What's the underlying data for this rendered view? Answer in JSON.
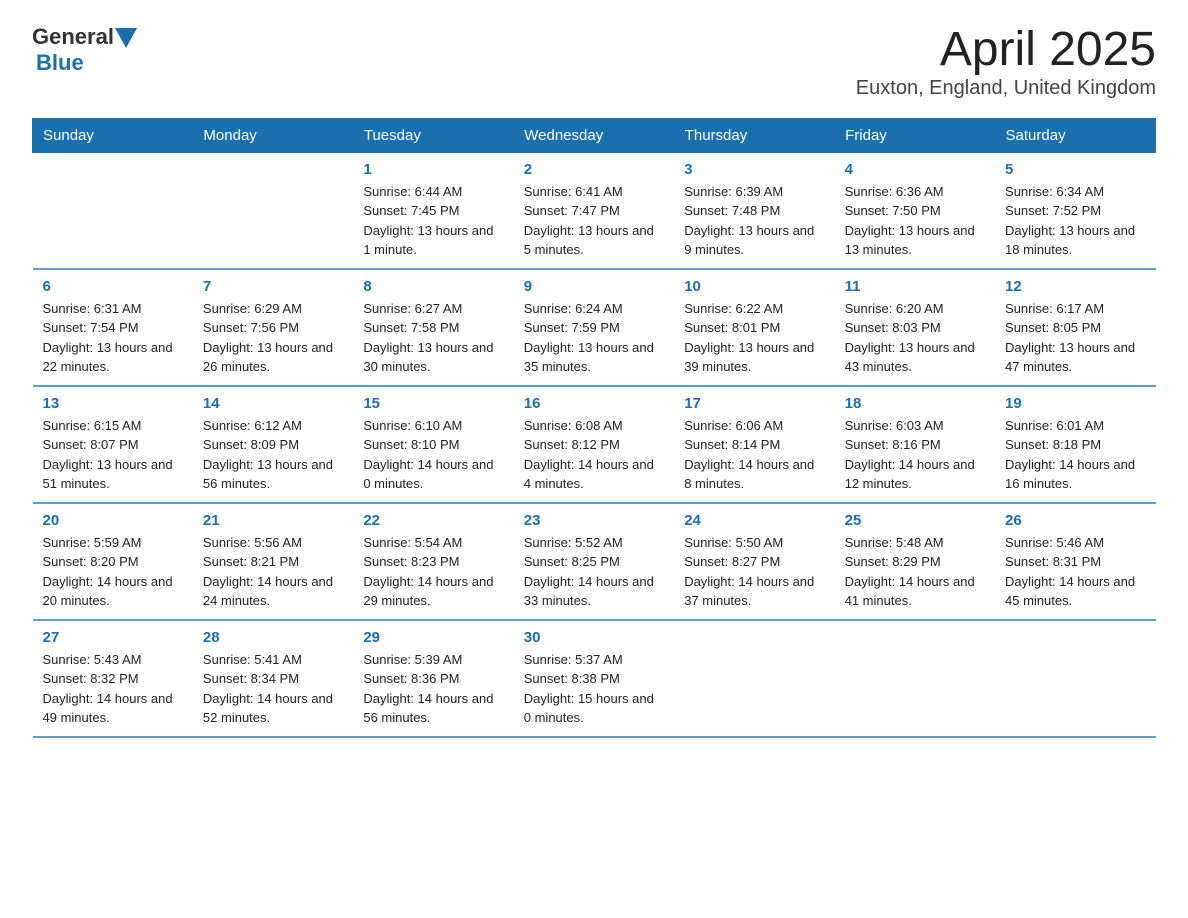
{
  "logo": {
    "general": "General",
    "blue": "Blue"
  },
  "title": "April 2025",
  "subtitle": "Euxton, England, United Kingdom",
  "days_of_week": [
    "Sunday",
    "Monday",
    "Tuesday",
    "Wednesday",
    "Thursday",
    "Friday",
    "Saturday"
  ],
  "weeks": [
    [
      {
        "day": "",
        "info": ""
      },
      {
        "day": "",
        "info": ""
      },
      {
        "day": "1",
        "info": "Sunrise: 6:44 AM\nSunset: 7:45 PM\nDaylight: 13 hours and 1 minute."
      },
      {
        "day": "2",
        "info": "Sunrise: 6:41 AM\nSunset: 7:47 PM\nDaylight: 13 hours and 5 minutes."
      },
      {
        "day": "3",
        "info": "Sunrise: 6:39 AM\nSunset: 7:48 PM\nDaylight: 13 hours and 9 minutes."
      },
      {
        "day": "4",
        "info": "Sunrise: 6:36 AM\nSunset: 7:50 PM\nDaylight: 13 hours and 13 minutes."
      },
      {
        "day": "5",
        "info": "Sunrise: 6:34 AM\nSunset: 7:52 PM\nDaylight: 13 hours and 18 minutes."
      }
    ],
    [
      {
        "day": "6",
        "info": "Sunrise: 6:31 AM\nSunset: 7:54 PM\nDaylight: 13 hours and 22 minutes."
      },
      {
        "day": "7",
        "info": "Sunrise: 6:29 AM\nSunset: 7:56 PM\nDaylight: 13 hours and 26 minutes."
      },
      {
        "day": "8",
        "info": "Sunrise: 6:27 AM\nSunset: 7:58 PM\nDaylight: 13 hours and 30 minutes."
      },
      {
        "day": "9",
        "info": "Sunrise: 6:24 AM\nSunset: 7:59 PM\nDaylight: 13 hours and 35 minutes."
      },
      {
        "day": "10",
        "info": "Sunrise: 6:22 AM\nSunset: 8:01 PM\nDaylight: 13 hours and 39 minutes."
      },
      {
        "day": "11",
        "info": "Sunrise: 6:20 AM\nSunset: 8:03 PM\nDaylight: 13 hours and 43 minutes."
      },
      {
        "day": "12",
        "info": "Sunrise: 6:17 AM\nSunset: 8:05 PM\nDaylight: 13 hours and 47 minutes."
      }
    ],
    [
      {
        "day": "13",
        "info": "Sunrise: 6:15 AM\nSunset: 8:07 PM\nDaylight: 13 hours and 51 minutes."
      },
      {
        "day": "14",
        "info": "Sunrise: 6:12 AM\nSunset: 8:09 PM\nDaylight: 13 hours and 56 minutes."
      },
      {
        "day": "15",
        "info": "Sunrise: 6:10 AM\nSunset: 8:10 PM\nDaylight: 14 hours and 0 minutes."
      },
      {
        "day": "16",
        "info": "Sunrise: 6:08 AM\nSunset: 8:12 PM\nDaylight: 14 hours and 4 minutes."
      },
      {
        "day": "17",
        "info": "Sunrise: 6:06 AM\nSunset: 8:14 PM\nDaylight: 14 hours and 8 minutes."
      },
      {
        "day": "18",
        "info": "Sunrise: 6:03 AM\nSunset: 8:16 PM\nDaylight: 14 hours and 12 minutes."
      },
      {
        "day": "19",
        "info": "Sunrise: 6:01 AM\nSunset: 8:18 PM\nDaylight: 14 hours and 16 minutes."
      }
    ],
    [
      {
        "day": "20",
        "info": "Sunrise: 5:59 AM\nSunset: 8:20 PM\nDaylight: 14 hours and 20 minutes."
      },
      {
        "day": "21",
        "info": "Sunrise: 5:56 AM\nSunset: 8:21 PM\nDaylight: 14 hours and 24 minutes."
      },
      {
        "day": "22",
        "info": "Sunrise: 5:54 AM\nSunset: 8:23 PM\nDaylight: 14 hours and 29 minutes."
      },
      {
        "day": "23",
        "info": "Sunrise: 5:52 AM\nSunset: 8:25 PM\nDaylight: 14 hours and 33 minutes."
      },
      {
        "day": "24",
        "info": "Sunrise: 5:50 AM\nSunset: 8:27 PM\nDaylight: 14 hours and 37 minutes."
      },
      {
        "day": "25",
        "info": "Sunrise: 5:48 AM\nSunset: 8:29 PM\nDaylight: 14 hours and 41 minutes."
      },
      {
        "day": "26",
        "info": "Sunrise: 5:46 AM\nSunset: 8:31 PM\nDaylight: 14 hours and 45 minutes."
      }
    ],
    [
      {
        "day": "27",
        "info": "Sunrise: 5:43 AM\nSunset: 8:32 PM\nDaylight: 14 hours and 49 minutes."
      },
      {
        "day": "28",
        "info": "Sunrise: 5:41 AM\nSunset: 8:34 PM\nDaylight: 14 hours and 52 minutes."
      },
      {
        "day": "29",
        "info": "Sunrise: 5:39 AM\nSunset: 8:36 PM\nDaylight: 14 hours and 56 minutes."
      },
      {
        "day": "30",
        "info": "Sunrise: 5:37 AM\nSunset: 8:38 PM\nDaylight: 15 hours and 0 minutes."
      },
      {
        "day": "",
        "info": ""
      },
      {
        "day": "",
        "info": ""
      },
      {
        "day": "",
        "info": ""
      }
    ]
  ]
}
